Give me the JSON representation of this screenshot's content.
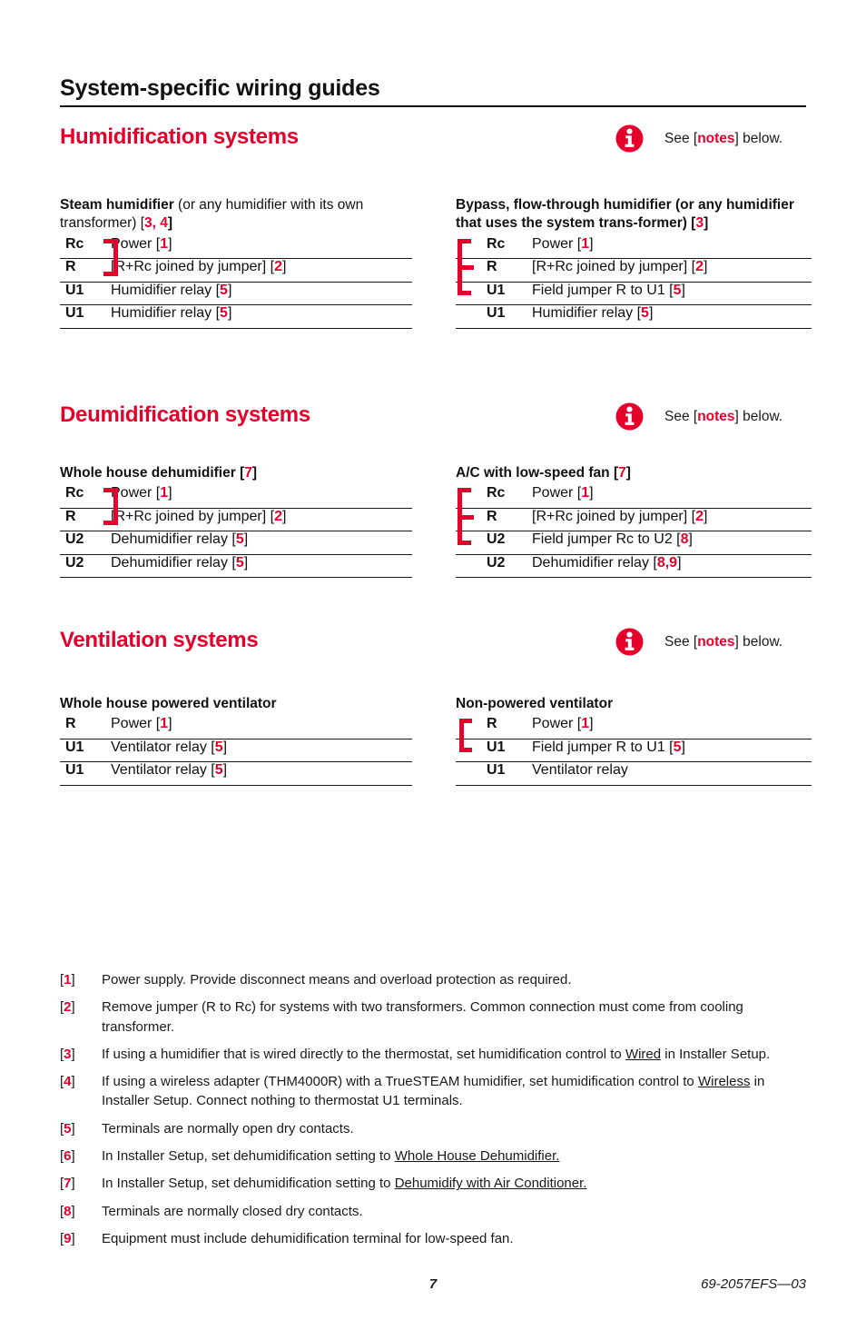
{
  "page": {
    "title": "System-specific wiring guides",
    "footer_page_number": "7",
    "footer_doc_code": "69-2057EFS—03"
  },
  "colors": {
    "accent_red": "#E4002B",
    "text_black": "#1a1a1a"
  },
  "notes_hint": {
    "icon": "info-icon",
    "prefix": "See [",
    "link": "notes",
    "suffix": "] below."
  },
  "sections": [
    {
      "id": "humidification",
      "title": "Humidification systems",
      "left_block": {
        "title_bold": "Steam humidifier",
        "title_rest": " (or any humidifier with its own transformer) [",
        "title_refs": "3, 4",
        "title_end": "]",
        "bracket": "right-2row",
        "rows": [
          {
            "terminal": "Rc",
            "desc": "Power [",
            "ref": "1",
            "desc_end": "]"
          },
          {
            "terminal": "R",
            "desc": "[R+Rc joined by jumper] [",
            "ref": "2",
            "desc_end": "]"
          },
          {
            "terminal": "U1",
            "desc": "Humidifier relay [",
            "ref": "5",
            "desc_end": "]"
          },
          {
            "terminal": "U1",
            "desc": "Humidifier relay [",
            "ref": "5",
            "desc_end": "]"
          }
        ]
      },
      "right_block": {
        "title_bold": "Bypass, flow-through humidifier (or any humidifier that uses the system trans-former) [",
        "title_refs": "3",
        "title_end": "]",
        "bracket": "left-3row",
        "rows": [
          {
            "terminal": "Rc",
            "desc": "Power [",
            "ref": "1",
            "desc_end": "]"
          },
          {
            "terminal": "R",
            "desc": "[R+Rc joined by jumper] [",
            "ref": "2",
            "desc_end": "]"
          },
          {
            "terminal": "U1",
            "desc": "Field jumper R to U1 [",
            "ref": "5",
            "desc_end": "]"
          },
          {
            "terminal": "U1",
            "desc": "Humidifier relay [",
            "ref": "5",
            "desc_end": "]"
          }
        ]
      }
    },
    {
      "id": "dehumidification",
      "title": "Deumidification systems",
      "left_block": {
        "title_bold": "Whole house dehumidifier [",
        "title_refs": "7",
        "title_end": "]",
        "bracket": "right-2row",
        "rows": [
          {
            "terminal": "Rc",
            "desc": "Power [",
            "ref": "1",
            "desc_end": "]"
          },
          {
            "terminal": "R",
            "desc": "[R+Rc joined by jumper] [",
            "ref": "2",
            "desc_end": "]"
          },
          {
            "terminal": "U2",
            "desc": "Dehumidifier relay [",
            "ref": "5",
            "desc_end": "]"
          },
          {
            "terminal": "U2",
            "desc": "Dehumidifier relay [",
            "ref": "5",
            "desc_end": "]"
          }
        ]
      },
      "right_block": {
        "title_bold": "A/C with low-speed fan [",
        "title_refs": "7",
        "title_end": "]",
        "bracket": "left-3row",
        "rows": [
          {
            "terminal": "Rc",
            "desc": "Power [",
            "ref": "1",
            "desc_end": "]"
          },
          {
            "terminal": "R",
            "desc": "[R+Rc joined by jumper] [",
            "ref": "2",
            "desc_end": "]"
          },
          {
            "terminal": "U2",
            "desc": "Field jumper Rc to U2 [",
            "ref": "8",
            "desc_end": "]"
          },
          {
            "terminal": "U2",
            "desc": "Dehumidifier relay [",
            "ref": "8,9",
            "desc_end": "]"
          }
        ]
      }
    },
    {
      "id": "ventilation",
      "title": "Ventilation systems",
      "left_block": {
        "title_bold": "Whole house powered ventilator",
        "title_refs": "",
        "title_end": "",
        "bracket": "none",
        "rows": [
          {
            "terminal": "R",
            "desc": "Power [",
            "ref": "1",
            "desc_end": "]"
          },
          {
            "terminal": "U1",
            "desc": "Ventilator relay [",
            "ref": "5",
            "desc_end": "]"
          },
          {
            "terminal": "U1",
            "desc": "Ventilator relay [",
            "ref": "5",
            "desc_end": "]"
          }
        ]
      },
      "right_block": {
        "title_bold": "Non-powered ventilator",
        "title_refs": "",
        "title_end": "",
        "bracket": "left-2row",
        "rows": [
          {
            "terminal": "R",
            "desc": "Power [",
            "ref": "1",
            "desc_end": "]"
          },
          {
            "terminal": "U1",
            "desc": "Field jumper R to U1 [",
            "ref": "5",
            "desc_end": "]"
          },
          {
            "terminal": "U1",
            "desc": "Ventilator relay",
            "ref": "",
            "desc_end": ""
          }
        ]
      }
    }
  ],
  "footnotes": [
    {
      "num": "1",
      "text": "Power supply. Provide disconnect means and overload protection as required."
    },
    {
      "num": "2",
      "text": "Remove jumper (R to Rc) for systems with two transformers. Common connection must come from cooling transformer."
    },
    {
      "num": "3",
      "text": "If using a humidifier that is wired directly to the thermostat, set humidification control to Wired in Installer Setup.",
      "underline": "Wired"
    },
    {
      "num": "4",
      "text": "If using a wireless adapter (THM4000R) with a TrueSTEAM humidifier, set humidification control to Wireless in Installer Setup. Connect nothing to thermostat U1 terminals.",
      "underline": "Wireless"
    },
    {
      "num": "5",
      "text": "Terminals are normally open dry contacts."
    },
    {
      "num": "6",
      "text": "In Installer Setup, set dehumidification setting to Whole House Dehumidifier.",
      "underline": "Whole House Dehumidifier."
    },
    {
      "num": "7",
      "text": "In Installer Setup, set dehumidification setting to Dehumidify with Air Conditioner.",
      "underline": "Dehumidify with Air Conditioner."
    },
    {
      "num": "8",
      "text": "Terminals are normally closed dry contacts."
    },
    {
      "num": "9",
      "text": "Equipment must include dehumidification terminal for low-speed fan."
    }
  ]
}
